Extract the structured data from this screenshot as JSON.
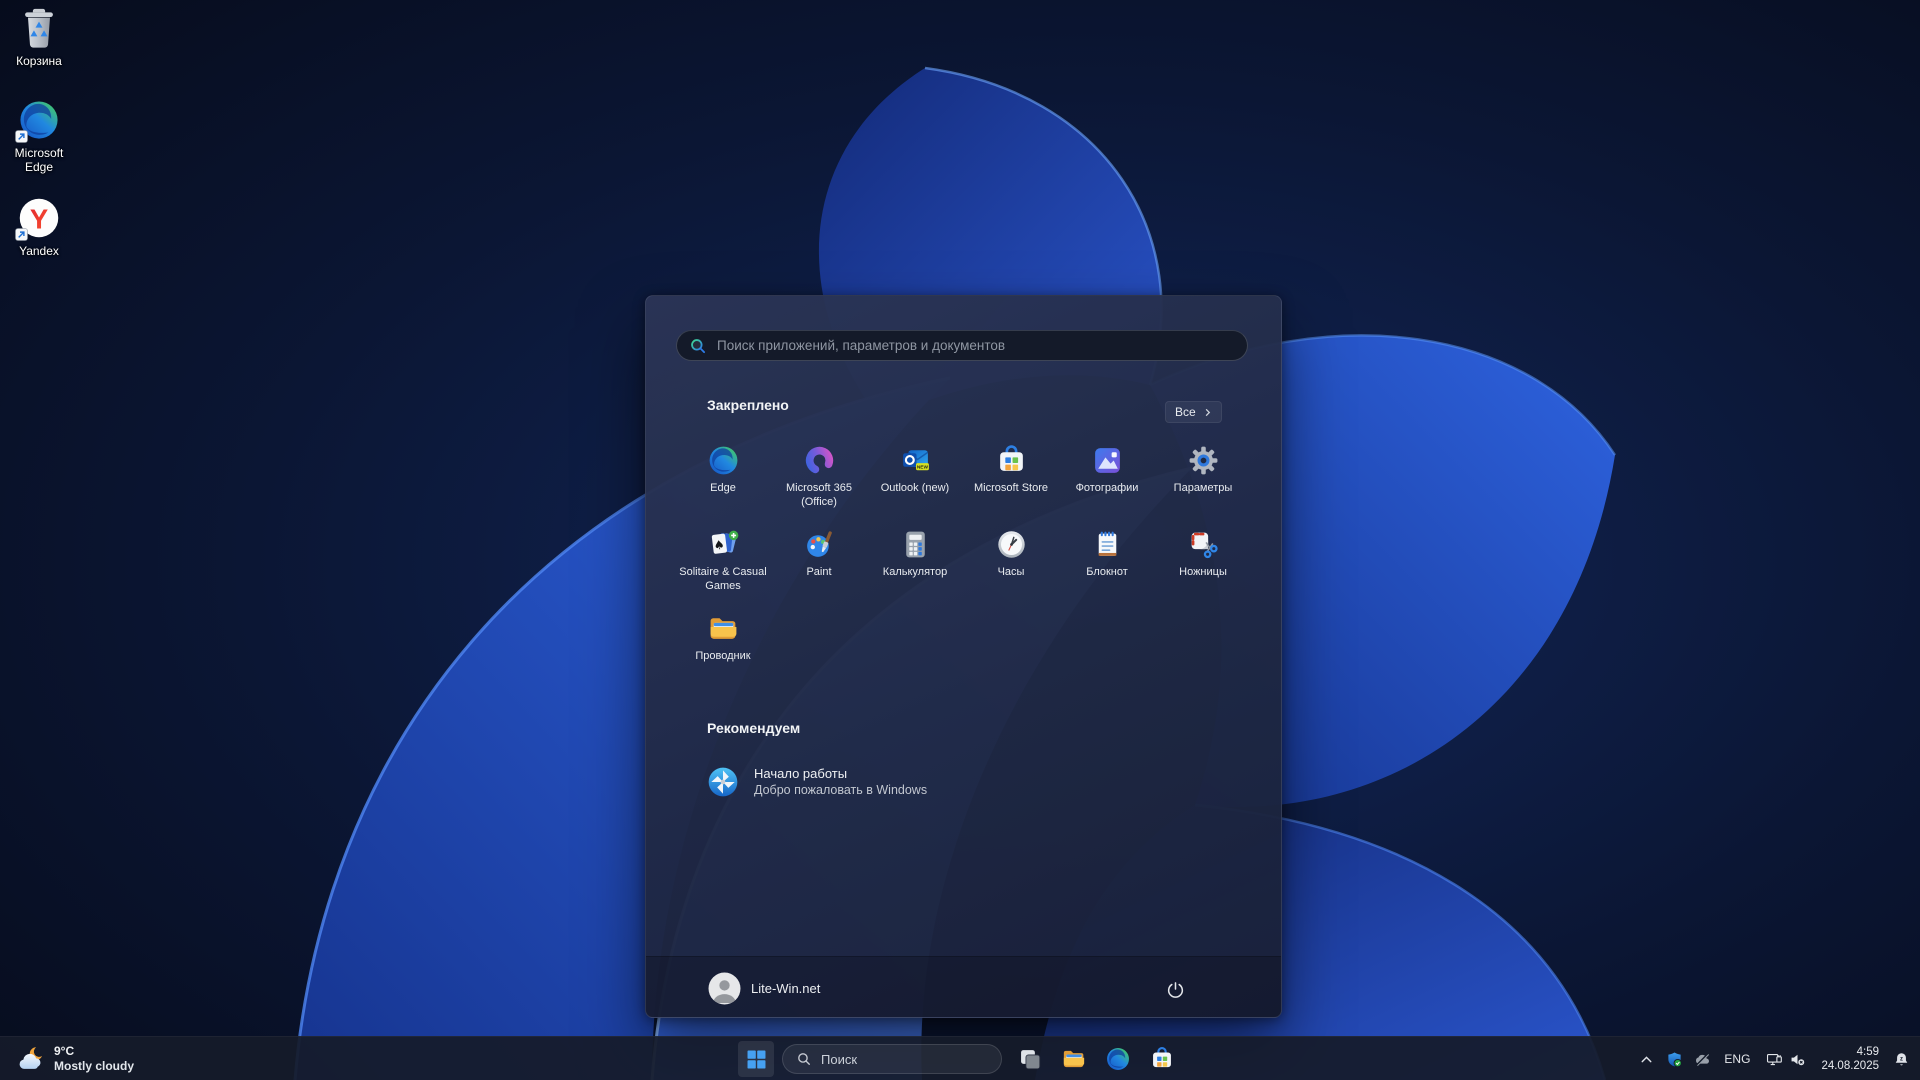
{
  "desktop": {
    "icons": [
      {
        "label": "Корзина",
        "icon": "recycle",
        "shortcut": false
      },
      {
        "label": "Microsoft Edge",
        "icon": "edge",
        "shortcut": true
      },
      {
        "label": "Yandex",
        "icon": "yandex",
        "shortcut": true
      }
    ]
  },
  "start_menu": {
    "search_placeholder": "Поиск приложений, параметров и документов",
    "pinned_title": "Закреплено",
    "all_button": "Все",
    "pinned_apps": [
      {
        "label": "Edge",
        "icon": "edge"
      },
      {
        "label": "Microsoft 365 (Office)",
        "icon": "m365"
      },
      {
        "label": "Outlook (new)",
        "icon": "outlook",
        "badge": "NEW"
      },
      {
        "label": "Microsoft Store",
        "icon": "store"
      },
      {
        "label": "Фотографии",
        "icon": "photos"
      },
      {
        "label": "Параметры",
        "icon": "settings"
      },
      {
        "label": "Solitaire & Casual Games",
        "icon": "solitaire"
      },
      {
        "label": "Paint",
        "icon": "paint"
      },
      {
        "label": "Калькулятор",
        "icon": "calculator"
      },
      {
        "label": "Часы",
        "icon": "clock"
      },
      {
        "label": "Блокнот",
        "icon": "notepad"
      },
      {
        "label": "Ножницы",
        "icon": "snipping"
      },
      {
        "label": "Проводник",
        "icon": "explorer"
      }
    ],
    "recommended_title": "Рекомендуем",
    "recommended": [
      {
        "title": "Начало работы",
        "subtitle": "Добро пожаловать в Windows",
        "icon": "getstarted"
      }
    ],
    "user_name": "Lite-Win.net"
  },
  "taskbar": {
    "weather": {
      "temperature": "9°C",
      "condition": "Mostly cloudy"
    },
    "search_label": "Поиск",
    "center_icons": [
      "windows-start",
      "task-view",
      "file-explorer",
      "edge",
      "microsoft-store"
    ],
    "tray": {
      "icons": [
        "chevron-up",
        "defender-shield",
        "onedrive-offline",
        "network-monitor",
        "volume-muted",
        "notification-bell-dnd"
      ],
      "language": "ENG",
      "time": "4:59",
      "date": "24.08.2025"
    }
  },
  "colors": {
    "accent": "#2f79dd",
    "wallpaper_blue": "#2e63e0",
    "menu_bg": "#202944",
    "taskbar_bg": "#151b2a"
  }
}
